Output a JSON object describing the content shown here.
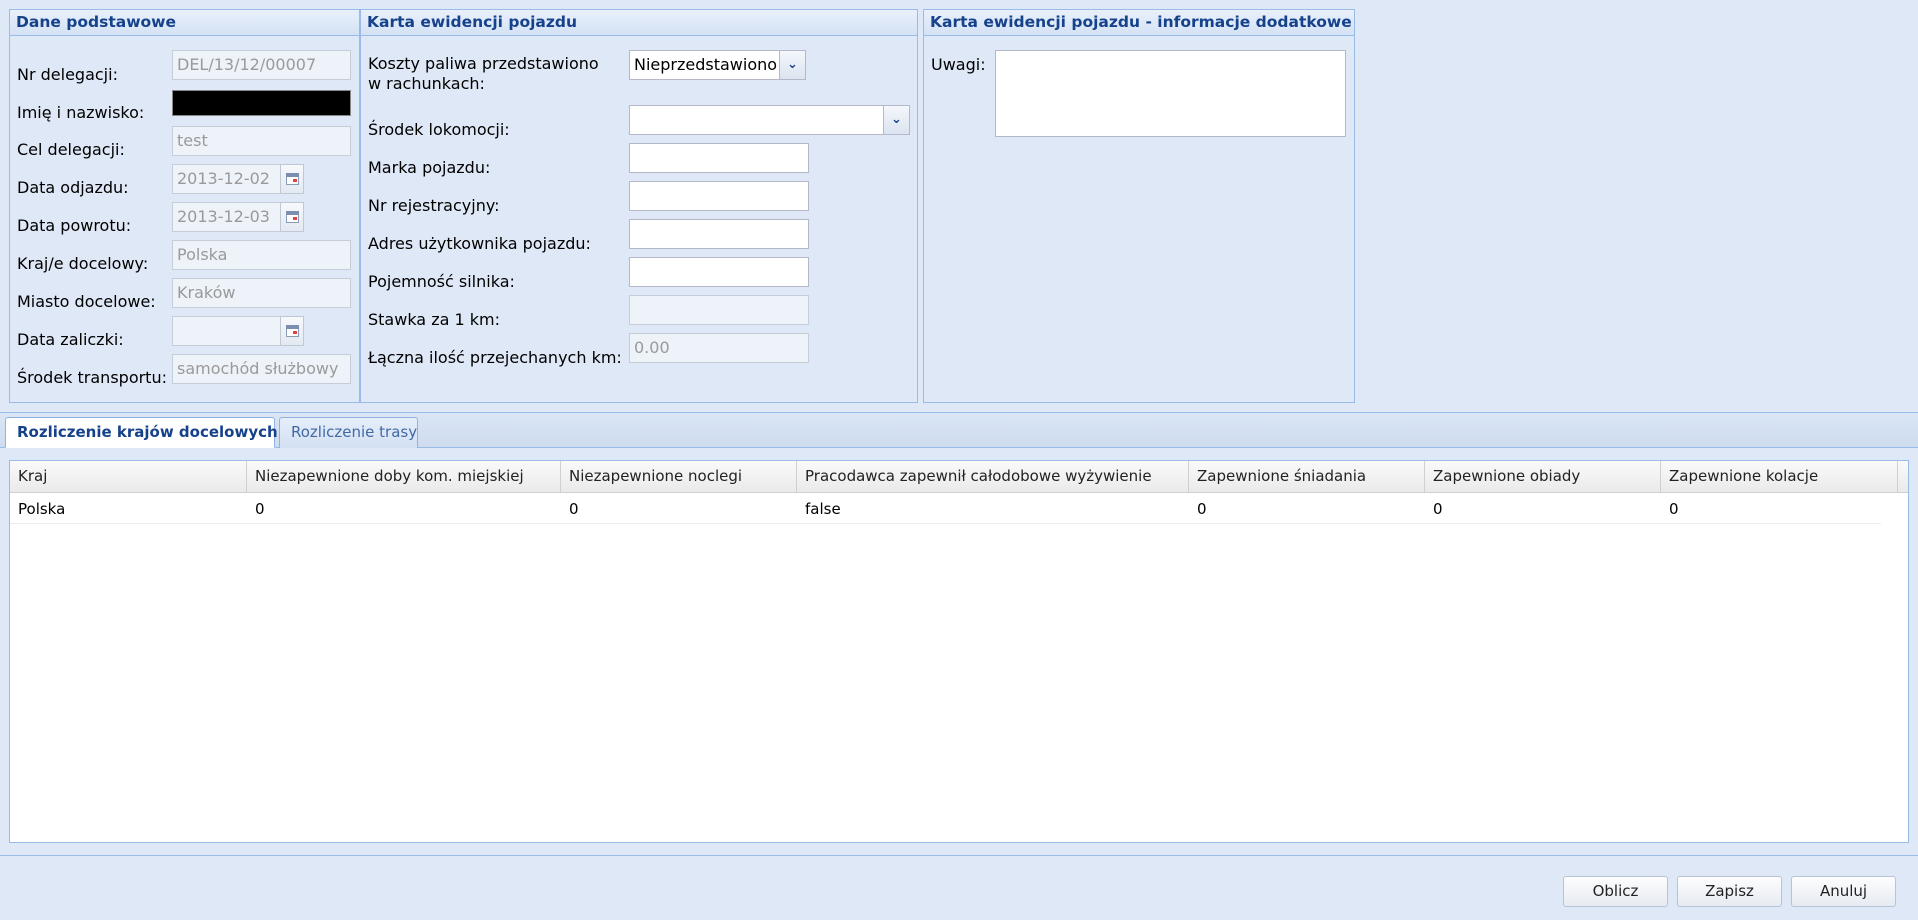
{
  "basic": {
    "title": "Dane podstawowe",
    "nr_delegacji_label": "Nr delegacji:",
    "nr_delegacji_value": "DEL/13/12/00007",
    "imie_label": "Imię i nazwisko:",
    "cel_label": "Cel delegacji:",
    "cel_value": "test",
    "data_odjazdu_label": "Data odjazdu:",
    "data_odjazdu_value": "2013-12-02",
    "data_powrotu_label": "Data powrotu:",
    "data_powrotu_value": "2013-12-03",
    "kraj_label": "Kraj/e docelowy:",
    "kraj_value": "Polska",
    "miasto_label": "Miasto docelowe:",
    "miasto_value": "Kraków",
    "data_zaliczki_label": "Data zaliczki:",
    "data_zaliczki_value": "",
    "srodek_transportu_label": "Środek transportu:",
    "srodek_transportu_value": "samochód służbowy"
  },
  "vehicle": {
    "title": "Karta ewidencji pojazdu",
    "koszty_label": "Koszty paliwa przedstawiono w rachunkach:",
    "koszty_value": "Nieprzedstawiono",
    "srodek_lok_label": "Środek lokomocji:",
    "srodek_lok_value": "",
    "marka_label": "Marka pojazdu:",
    "marka_value": "",
    "nr_rej_label": "Nr rejestracyjny:",
    "nr_rej_value": "",
    "adres_label": "Adres użytkownika pojazdu:",
    "adres_value": "",
    "pojemnosc_label": "Pojemność silnika:",
    "pojemnosc_value": "",
    "stawka_label": "Stawka za 1 km:",
    "stawka_value": "",
    "laczna_label": "Łączna ilość przejechanych km:",
    "laczna_value": "0.00"
  },
  "extra": {
    "title": "Karta ewidencji pojazdu - informacje dodatkowe",
    "uwagi_label": "Uwagi:",
    "uwagi_value": ""
  },
  "tabs": [
    {
      "label": "Rozliczenie krajów docelowych"
    },
    {
      "label": "Rozliczenie trasy"
    }
  ],
  "grid": {
    "columns": [
      "Kraj",
      "Niezapewnione doby kom. miejskiej",
      "Niezapewnione noclegi",
      "Pracodawca zapewnił całodobowe wyżywienie",
      "Zapewnione śniadania",
      "Zapewnione obiady",
      "Zapewnione kolacje"
    ],
    "rows": [
      [
        "Polska",
        "0",
        "0",
        "false",
        "0",
        "0",
        "0"
      ]
    ]
  },
  "buttons": {
    "oblicz": "Oblicz",
    "zapisz": "Zapisz",
    "anuluj": "Anuluj"
  },
  "icons": {
    "date": "calendar-icon",
    "combo": "chevron-down-icon"
  }
}
